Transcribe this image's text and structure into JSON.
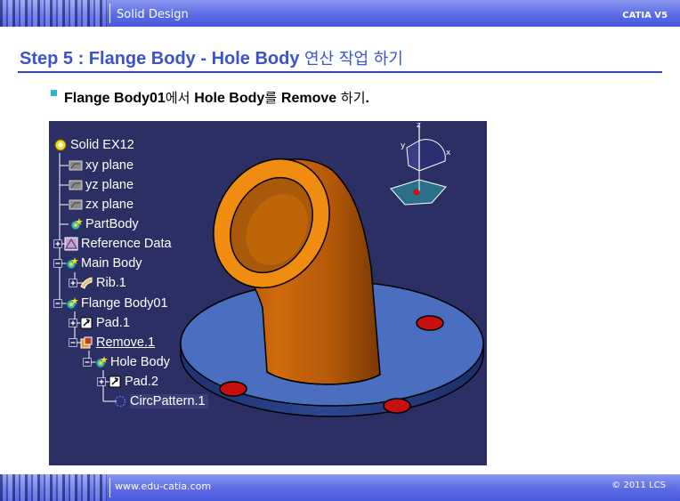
{
  "header": {
    "title": "Solid Design",
    "product": "CATIA V5"
  },
  "slide": {
    "title_en": "Step 5 : Flange Body - Hole Body",
    "title_ko": "연산 작업 하기"
  },
  "bullet": {
    "part1": "Flange Body01",
    "part2": "에서 ",
    "part3": "Hole Body",
    "part4": "를 ",
    "part5": "Remove",
    "part6": " 하기",
    "part7": "."
  },
  "tree": [
    {
      "label": "Solid EX12",
      "icon": "product-icon",
      "expander": "none"
    },
    {
      "label": "xy plane",
      "icon": "plane-icon",
      "expander": "none"
    },
    {
      "label": "yz plane",
      "icon": "plane-icon",
      "expander": "none"
    },
    {
      "label": "zx plane",
      "icon": "plane-icon",
      "expander": "none"
    },
    {
      "label": "PartBody",
      "icon": "body-icon",
      "expander": "none"
    },
    {
      "label": "Reference Data",
      "icon": "geoset-icon",
      "expander": "plus"
    },
    {
      "label": "Main Body",
      "icon": "body-icon",
      "expander": "minus"
    },
    {
      "label": "Rib.1",
      "icon": "rib-icon",
      "expander": "plus"
    },
    {
      "label": "Flange Body01",
      "icon": "body-icon",
      "expander": "minus"
    },
    {
      "label": "Pad.1",
      "icon": "pad-icon",
      "expander": "plus"
    },
    {
      "label": "Remove.1",
      "icon": "remove-icon",
      "expander": "minus"
    },
    {
      "label": "Hole Body",
      "icon": "body-icon",
      "expander": "minus"
    },
    {
      "label": "Pad.2",
      "icon": "pad-icon",
      "expander": "plus"
    },
    {
      "label": "CircPattern.1",
      "icon": "circpattern-icon",
      "expander": "none"
    }
  ],
  "compass": {
    "x": "x",
    "y": "y",
    "z": "z"
  },
  "footer": {
    "url": "www.edu-catia.com",
    "copyright": "© 2011 LCS"
  },
  "colors": {
    "accent": "#3d52d0",
    "viewport_bg": "#2c2f64",
    "flange": "#4a6fc0",
    "pipe": "#e07a10",
    "holes": "#c81010"
  }
}
